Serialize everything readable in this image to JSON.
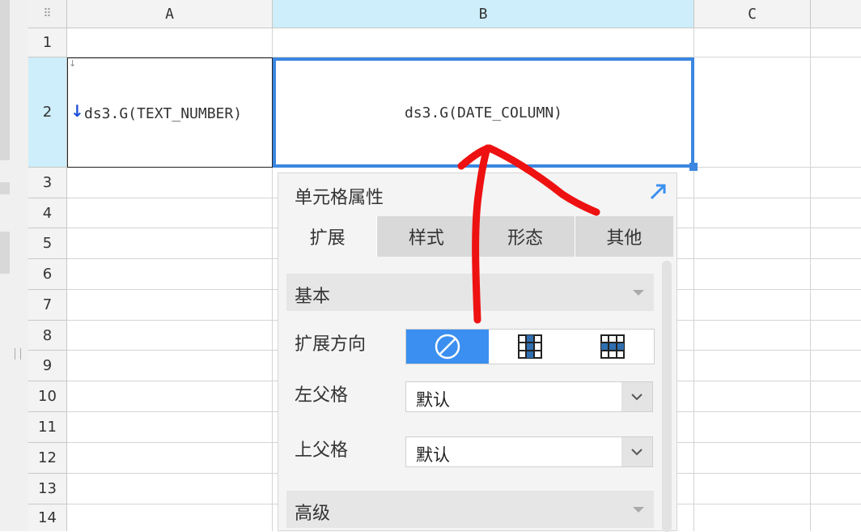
{
  "columns": [
    "A",
    "B",
    "C"
  ],
  "rows": [
    "1",
    "2",
    "3",
    "4",
    "5",
    "6",
    "7",
    "8",
    "9",
    "10",
    "11",
    "12",
    "13",
    "14"
  ],
  "cells": {
    "a2": "ds3.G(TEXT_NUMBER)",
    "b2": "ds3.G(DATE_COLUMN)"
  },
  "panel": {
    "title": "单元格属性",
    "tabs": [
      "扩展",
      "样式",
      "形态",
      "其他"
    ],
    "section_basic": "基本",
    "expand_direction_label": "扩展方向",
    "left_parent_label": "左父格",
    "left_parent_value": "默认",
    "top_parent_label": "上父格",
    "top_parent_value": "默认",
    "section_advanced": "高级"
  },
  "colors": {
    "accent": "#3b86e0",
    "annotation": "#ee1111"
  }
}
